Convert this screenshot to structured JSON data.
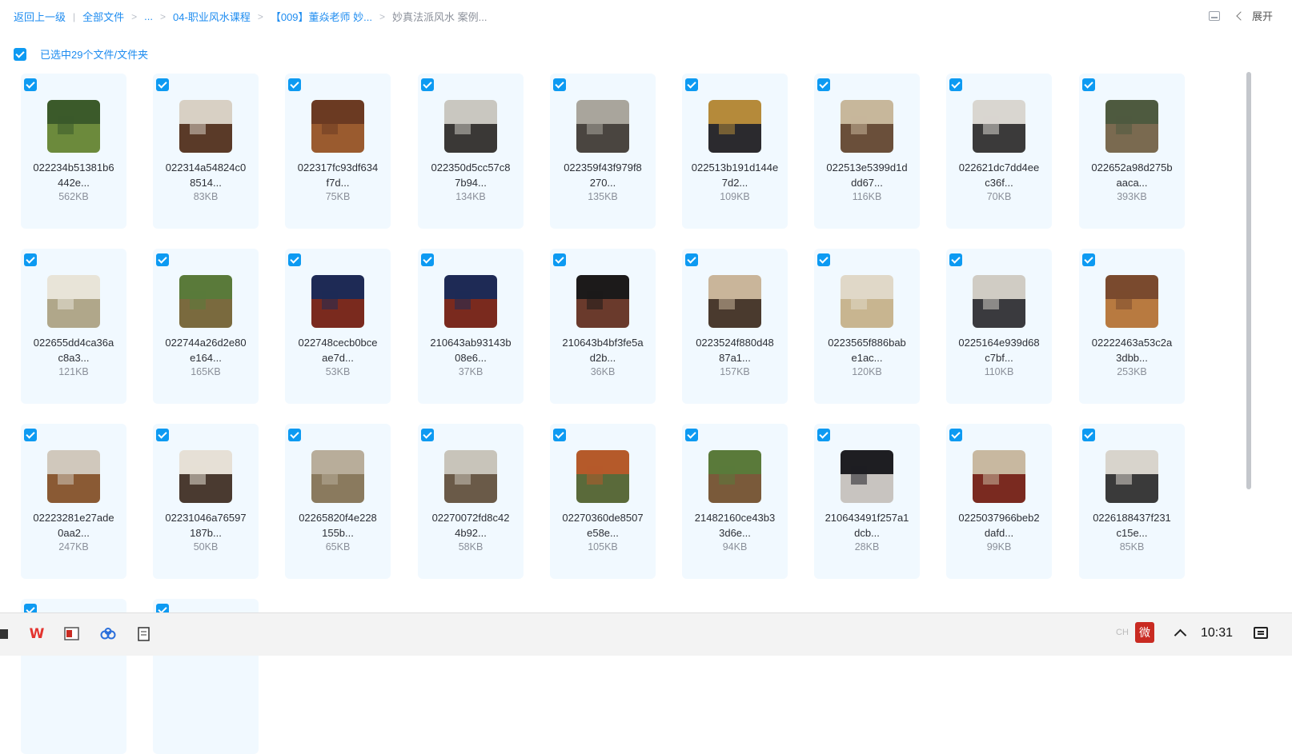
{
  "breadcrumb": {
    "back": "返回上一级",
    "all_files": "全部文件",
    "ellipsis": "...",
    "level1": "04-职业风水课程",
    "level2": "【009】董焱老师 妙...",
    "current": "妙真法派风水 案例..."
  },
  "toolbar": {
    "expand_label": "展开"
  },
  "selection": {
    "label": "已选中29个文件/文件夹"
  },
  "files": [
    {
      "name1": "022234b51381b6",
      "name2": "442e...",
      "size": "562KB",
      "c1": "#3b5a2a",
      "c2": "#6c8a3c"
    },
    {
      "name1": "022314a54824c0",
      "name2": "8514...",
      "size": "83KB",
      "c1": "#d8d0c4",
      "c2": "#5a3a28"
    },
    {
      "name1": "022317fc93df634",
      "name2": "f7d...",
      "size": "75KB",
      "c1": "#6b3a22",
      "c2": "#9a5b2f"
    },
    {
      "name1": "022350d5cc57c8",
      "name2": "7b94...",
      "size": "134KB",
      "c1": "#c9c7c0",
      "c2": "#3a3836"
    },
    {
      "name1": "022359f43f979f8",
      "name2": "270...",
      "size": "135KB",
      "c1": "#a9a59c",
      "c2": "#4a4540"
    },
    {
      "name1": "022513b191d144e",
      "name2": "7d2...",
      "size": "109KB",
      "c1": "#b58a3a",
      "c2": "#2b2a2e"
    },
    {
      "name1": "022513e5399d1d",
      "name2": "dd67...",
      "size": "116KB",
      "c1": "#c7b79b",
      "c2": "#6a4f3a"
    },
    {
      "name1": "022621dc7dd4ee",
      "name2": "c36f...",
      "size": "70KB",
      "c1": "#d9d6d0",
      "c2": "#3b3a3a"
    },
    {
      "name1": "022652a98d275b",
      "name2": "aaca...",
      "size": "393KB",
      "c1": "#4e5a3f",
      "c2": "#7a6a50"
    },
    {
      "name1": "022655dd4ca36a",
      "name2": "c8a3...",
      "size": "121KB",
      "c1": "#e8e4d8",
      "c2": "#b0a78a"
    },
    {
      "name1": "022744a26d2e80",
      "name2": "e164...",
      "size": "165KB",
      "c1": "#5a7a3a",
      "c2": "#7a6a3e"
    },
    {
      "name1": "022748cecb0bce",
      "name2": "ae7d...",
      "size": "53KB",
      "c1": "#1e2a55",
      "c2": "#7a2a1e"
    },
    {
      "name1": "210643ab93143b",
      "name2": "08e6...",
      "size": "37KB",
      "c1": "#1e2a55",
      "c2": "#7a2a1e"
    },
    {
      "name1": "210643b4bf3fe5a",
      "name2": "d2b...",
      "size": "36KB",
      "c1": "#1c1a1a",
      "c2": "#6a3a2c"
    },
    {
      "name1": "0223524f880d48",
      "name2": "87a1...",
      "size": "157KB",
      "c1": "#c9b59a",
      "c2": "#4a3a2e"
    },
    {
      "name1": "0223565f886bab",
      "name2": "e1ac...",
      "size": "120KB",
      "c1": "#e0d8c8",
      "c2": "#c8b590"
    },
    {
      "name1": "0225164e939d68",
      "name2": "c7bf...",
      "size": "110KB",
      "c1": "#d0ccc4",
      "c2": "#3a3a3e"
    },
    {
      "name1": "02222463a53c2a",
      "name2": "3dbb...",
      "size": "253KB",
      "c1": "#7a4a2e",
      "c2": "#b87a40"
    },
    {
      "name1": "02223281e27ade",
      "name2": "0aa2...",
      "size": "247KB",
      "c1": "#d0c8bc",
      "c2": "#8a5a34"
    },
    {
      "name1": "02231046a76597",
      "name2": "187b...",
      "size": "50KB",
      "c1": "#e6e0d6",
      "c2": "#4a3a30"
    },
    {
      "name1": "02265820f4e228",
      "name2": "155b...",
      "size": "65KB",
      "c1": "#b8ad9a",
      "c2": "#8a7a5e"
    },
    {
      "name1": "02270072fd8c42",
      "name2": "4b92...",
      "size": "58KB",
      "c1": "#c8c4ba",
      "c2": "#6a5a48"
    },
    {
      "name1": "02270360de8507",
      "name2": "e58e...",
      "size": "105KB",
      "c1": "#b55a2a",
      "c2": "#5a6a3a"
    },
    {
      "name1": "21482160ce43b3",
      "name2": "3d6e...",
      "size": "94KB",
      "c1": "#5a7a3a",
      "c2": "#7a5a3a"
    },
    {
      "name1": "210643491f257a1",
      "name2": "dcb...",
      "size": "28KB",
      "c1": "#1e1e22",
      "c2": "#c8c4c0"
    },
    {
      "name1": "0225037966beb2",
      "name2": "dafd...",
      "size": "99KB",
      "c1": "#c8b8a0",
      "c2": "#7a2a20"
    },
    {
      "name1": "02261884​37f231",
      "name2": "c15e...",
      "size": "85KB",
      "c1": "#d8d4cc",
      "c2": "#3a3a3a"
    }
  ],
  "taskbar": {
    "time": "10:31",
    "ime_label": "CH",
    "ime_glyph": "微"
  }
}
